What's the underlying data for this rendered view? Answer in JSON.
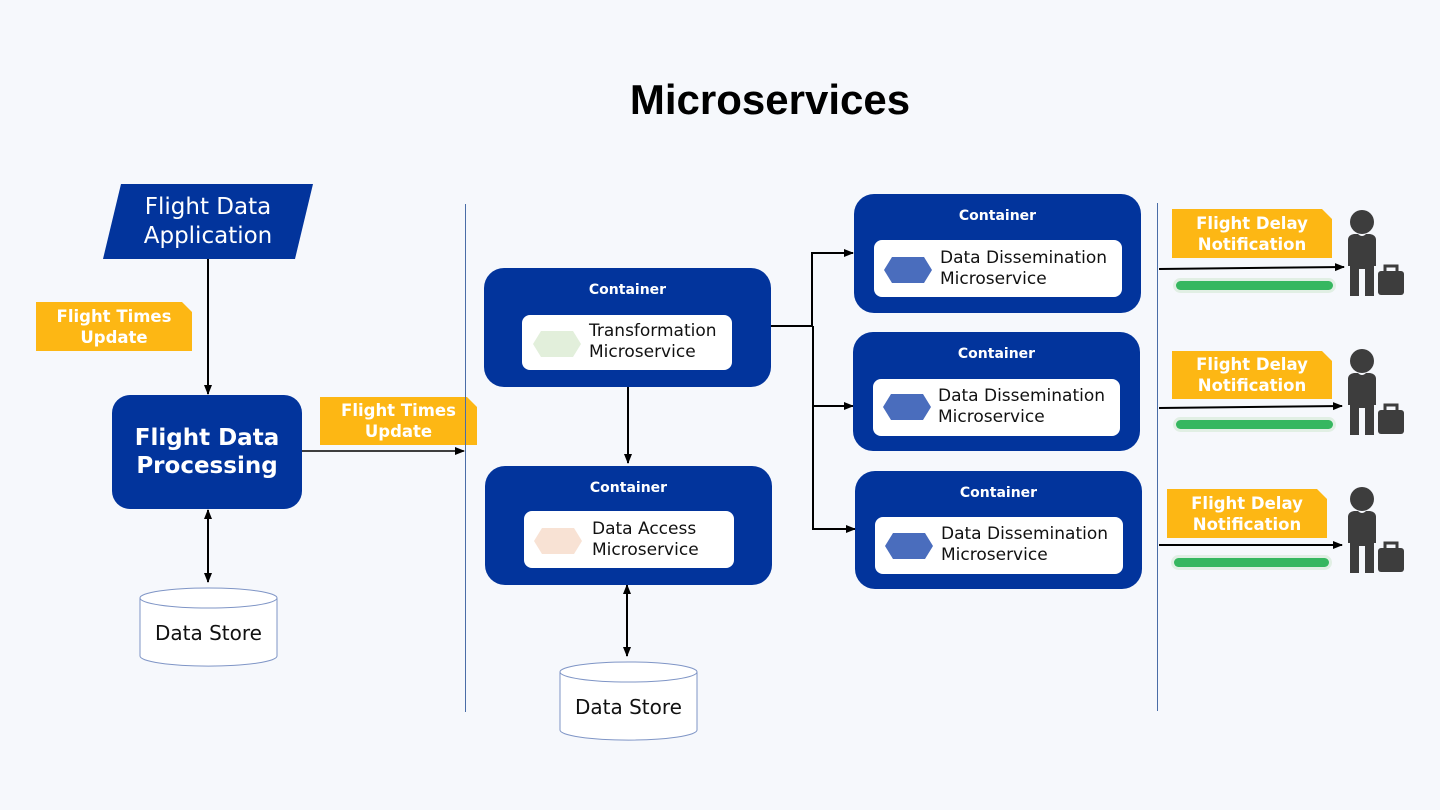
{
  "title": "Microservices",
  "colors": {
    "navy": "#02349c",
    "tag_yellow": "#fdb714",
    "background": "#f6f8fc",
    "progress_green": "#36b760",
    "hex_transformation": "#e2efdb",
    "hex_data_access": "#f8e2d4",
    "hex_dissemination": "#4a6dbd",
    "person_icon": "#3d3d3d"
  },
  "left": {
    "application": {
      "line1": "Flight Data",
      "line2": "Application"
    },
    "input_tag": {
      "line1": "Flight Times",
      "line2": "Update"
    },
    "processing": {
      "line1": "Flight Data",
      "line2": "Processing"
    },
    "data_store": "Data Store",
    "output_tag": {
      "line1": "Flight Times",
      "line2": "Update"
    }
  },
  "middle": {
    "transformation": {
      "container": "Container",
      "line1": "Transformation",
      "line2": "Microservice",
      "icon": "hexagon-icon"
    },
    "data_access": {
      "container": "Container",
      "line1": "Data Access",
      "line2": "Microservice",
      "icon": "hexagon-icon"
    },
    "data_store": "Data Store"
  },
  "dissemination": [
    {
      "container": "Container",
      "line1": "Data Dissemination",
      "line2": "Microservice",
      "icon": "hexagon-icon"
    },
    {
      "container": "Container",
      "line1": "Data Dissemination",
      "line2": "Microservice",
      "icon": "hexagon-icon"
    },
    {
      "container": "Container",
      "line1": "Data Dissemination",
      "line2": "Microservice",
      "icon": "hexagon-icon"
    }
  ],
  "notifications": [
    {
      "line1": "Flight Delay",
      "line2": "Notification",
      "progress": 100,
      "icon": "traveler-icon"
    },
    {
      "line1": "Flight Delay",
      "line2": "Notification",
      "progress": 100,
      "icon": "traveler-icon"
    },
    {
      "line1": "Flight Delay",
      "line2": "Notification",
      "progress": 100,
      "icon": "traveler-icon"
    }
  ]
}
